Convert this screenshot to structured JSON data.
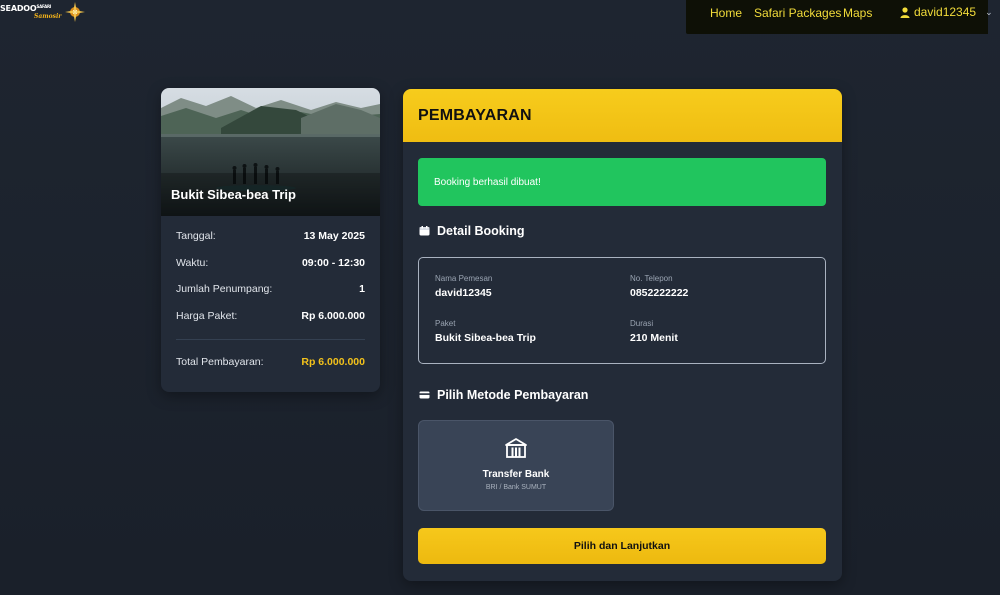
{
  "brand": {
    "name": "SEADOO",
    "name_suffix": "SAFARI",
    "tagline": "Samosir"
  },
  "nav": {
    "links": [
      "Home",
      "Safari Packages",
      "Maps"
    ],
    "user": "david12345",
    "user_icon": "user-icon",
    "caret_icon": "chevron-down-icon"
  },
  "summary": {
    "trip_name": "Bukit Sibea-bea Trip",
    "rows": [
      {
        "label": "Tanggal:",
        "value": "13 May 2025"
      },
      {
        "label": "Waktu:",
        "value": "09:00 - 12:30"
      },
      {
        "label": "Jumlah Penumpang:",
        "value": "1"
      },
      {
        "label": "Harga Paket:",
        "value": "Rp 6.000.000"
      }
    ],
    "total_label": "Total Pembayaran:",
    "total_value": "Rp 6.000.000"
  },
  "payment": {
    "title": "PEMBAYARAN",
    "alert": "Booking berhasil dibuat!",
    "detail_heading": "Detail Booking",
    "detail_icon": "calendar-icon",
    "fields": {
      "nama_label": "Nama Pemesan",
      "nama_value": "david12345",
      "telepon_label": "No. Telepon",
      "telepon_value": "0852222222",
      "paket_label": "Paket",
      "paket_value": "Bukit Sibea-bea Trip",
      "durasi_label": "Durasi",
      "durasi_value": "210 Menit"
    },
    "method_heading": "Pilih Metode Pembayaran",
    "method_icon": "credit-card-icon",
    "method": {
      "title": "Transfer Bank",
      "subtitle": "BRI / Bank SUMUT",
      "icon": "bank-icon"
    },
    "cta": "Pilih dan Lanjutkan"
  },
  "colors": {
    "accent": "#F5C518",
    "success": "#22C55E",
    "background": "#1E2530",
    "card": "#232B38",
    "nav_text": "#F2DC3A"
  }
}
